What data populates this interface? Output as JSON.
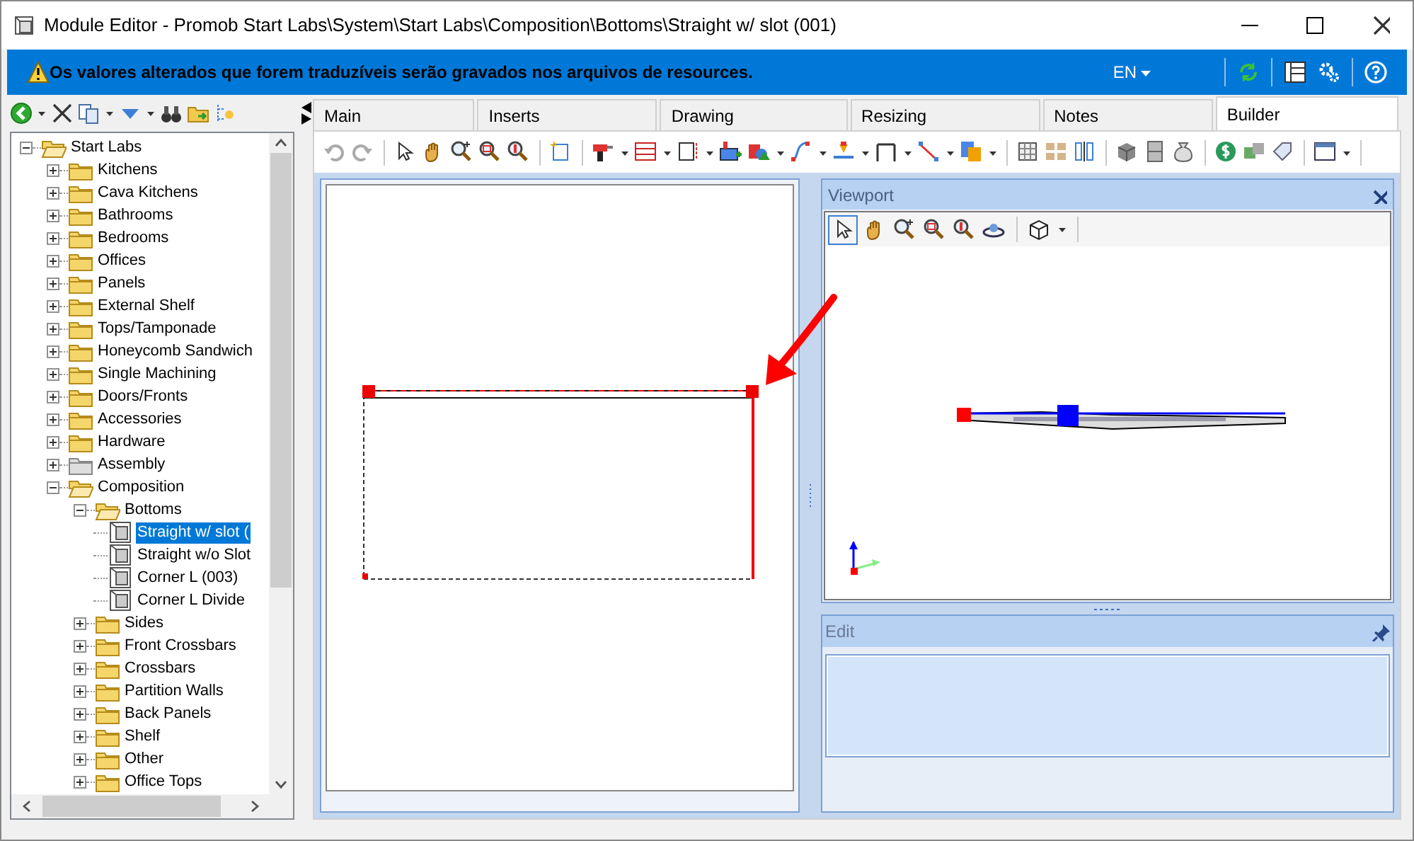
{
  "window": {
    "title": "Module Editor - Promob Start Labs\\System\\Start Labs\\Composition\\Bottoms\\Straight w/ slot (001)"
  },
  "banner": {
    "message": "Os valores alterados que forem traduzíveis serão gravados nos arquivos de resources.",
    "language": "EN"
  },
  "tree": [
    {
      "label": "Start Labs",
      "kind": "folder",
      "expanded": true,
      "selected": false,
      "children": [
        {
          "label": "Kitchens",
          "kind": "folder",
          "expanded": false,
          "selected": false
        },
        {
          "label": "Cava Kitchens",
          "kind": "folder",
          "expanded": false,
          "selected": false
        },
        {
          "label": "Bathrooms",
          "kind": "folder",
          "expanded": false,
          "selected": false
        },
        {
          "label": "Bedrooms",
          "kind": "folder",
          "expanded": false,
          "selected": false
        },
        {
          "label": "Offices",
          "kind": "folder",
          "expanded": false,
          "selected": false
        },
        {
          "label": "Panels",
          "kind": "folder",
          "expanded": false,
          "selected": false
        },
        {
          "label": "External Shelf",
          "kind": "folder",
          "expanded": false,
          "selected": false
        },
        {
          "label": "Tops/Tamponade",
          "kind": "folder",
          "expanded": false,
          "selected": false
        },
        {
          "label": "Honeycomb Sandwich",
          "kind": "folder",
          "expanded": false,
          "selected": false
        },
        {
          "label": "Single Machining",
          "kind": "folder",
          "expanded": false,
          "selected": false
        },
        {
          "label": "Doors/Fronts",
          "kind": "folder",
          "expanded": false,
          "selected": false
        },
        {
          "label": "Accessories",
          "kind": "folder",
          "expanded": false,
          "selected": false
        },
        {
          "label": "Hardware",
          "kind": "folder",
          "expanded": false,
          "selected": false
        },
        {
          "label": "Assembly",
          "kind": "grey-folder",
          "expanded": false,
          "selected": false
        },
        {
          "label": "Composition",
          "kind": "folder",
          "expanded": true,
          "selected": false,
          "children": [
            {
              "label": "Bottoms",
              "kind": "folder",
              "expanded": true,
              "selected": false,
              "children": [
                {
                  "label": "Straight w/ slot (",
                  "kind": "module",
                  "selected": true
                },
                {
                  "label": "Straight w/o Slot",
                  "kind": "module",
                  "selected": false
                },
                {
                  "label": "Corner L (003)",
                  "kind": "module",
                  "selected": false
                },
                {
                  "label": "Corner L Divide",
                  "kind": "module",
                  "selected": false
                }
              ]
            },
            {
              "label": "Sides",
              "kind": "folder",
              "expanded": false,
              "selected": false
            },
            {
              "label": "Front Crossbars",
              "kind": "folder",
              "expanded": false,
              "selected": false
            },
            {
              "label": "Crossbars",
              "kind": "folder",
              "expanded": false,
              "selected": false
            },
            {
              "label": "Partition Walls",
              "kind": "folder",
              "expanded": false,
              "selected": false
            },
            {
              "label": "Back Panels",
              "kind": "folder",
              "expanded": false,
              "selected": false
            },
            {
              "label": "Shelf",
              "kind": "folder",
              "expanded": false,
              "selected": false
            },
            {
              "label": "Other",
              "kind": "folder",
              "expanded": false,
              "selected": false
            },
            {
              "label": "Office Tops",
              "kind": "folder",
              "expanded": false,
              "selected": false
            }
          ]
        }
      ]
    }
  ],
  "tabs": [
    {
      "label": "Main",
      "selected": false
    },
    {
      "label": "Inserts",
      "selected": false
    },
    {
      "label": "Drawing",
      "selected": false
    },
    {
      "label": "Resizing",
      "selected": false
    },
    {
      "label": "Notes",
      "selected": false
    },
    {
      "label": "Builder",
      "selected": true
    }
  ],
  "viewport": {
    "title": "Viewport"
  },
  "edit_panel": {
    "title": "Edit"
  }
}
